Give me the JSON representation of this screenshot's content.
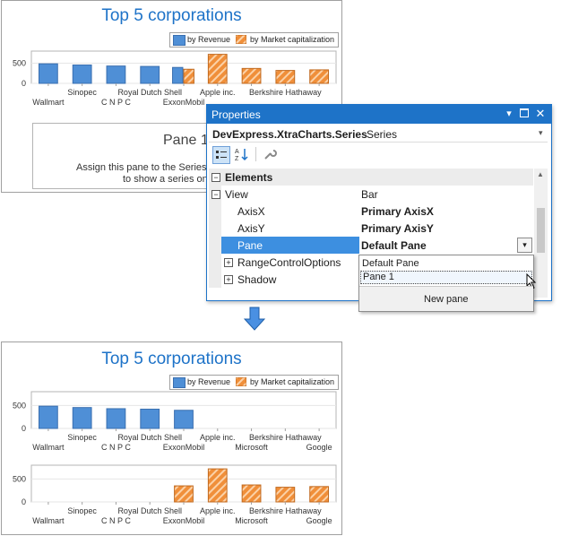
{
  "top_chart": {
    "title": "Top 5 corporations",
    "legend": {
      "revenue": "by Revenue",
      "market_cap": "by Market capitalization"
    },
    "y_ticks": [
      "500",
      "0"
    ],
    "x_labels_row1": [
      "Sinopec",
      "Royal Dutch Shell",
      "Apple inc.",
      "Berkshire Hathaway"
    ],
    "x_labels_row2": [
      "Wallmart",
      "C N P C",
      "ExxonMobil"
    ],
    "pane_title": "Pane 1",
    "pane_text_line1": "Assign this pane to the Series.",
    "pane_text_line2": "to show a series on"
  },
  "properties": {
    "caption": "Properties",
    "object_name": "DevExpress.XtraCharts.Series",
    "object_type": "Series",
    "category": "Elements",
    "rows": [
      {
        "key": "View",
        "value": "Bar"
      },
      {
        "key": "AxisX",
        "value": "Primary AxisX"
      },
      {
        "key": "AxisY",
        "value": "Primary AxisY"
      },
      {
        "key": "Pane",
        "value": "Default Pane"
      },
      {
        "key": "RangeControlOptions",
        "value": ""
      },
      {
        "key": "Shadow",
        "value": ""
      }
    ],
    "dropdown_options": [
      "Default Pane",
      "Pane 1"
    ],
    "new_pane": "New pane"
  },
  "bottom_chart": {
    "title": "Top 5 corporations",
    "legend": {
      "revenue": "by Revenue",
      "market_cap": "by Market capitalization"
    },
    "y_ticks": [
      "500",
      "0"
    ],
    "x_labels_row1": [
      "Sinopec",
      "Royal Dutch Shell",
      "Apple inc.",
      "Berkshire Hathaway"
    ],
    "x_labels_row2": [
      "Wallmart",
      "C N P C",
      "ExxonMobil",
      "Microsoft",
      "Google"
    ]
  },
  "colors": {
    "revenue": "#4f8fd6",
    "market_cap": "#f08f3a",
    "accent": "#1e73c8"
  },
  "chart_data": [
    {
      "type": "bar",
      "title": "Top 5 corporations",
      "categories": [
        "Wallmart",
        "Sinopec",
        "C N P C",
        "Royal Dutch Shell",
        "ExxonMobil",
        "Apple inc.",
        "Microsoft",
        "Berkshire Hathaway",
        "Google"
      ],
      "series": [
        {
          "name": "by Revenue",
          "values": [
            485,
            455,
            430,
            420,
            395,
            null,
            null,
            null,
            null
          ]
        },
        {
          "name": "by Market capitalization",
          "values": [
            null,
            null,
            null,
            null,
            350,
            720,
            370,
            320,
            335
          ]
        }
      ],
      "ylim": [
        0,
        800
      ],
      "grid": true,
      "legend_position": "top-right"
    },
    {
      "type": "bar",
      "title": "Top 5 corporations",
      "categories": [
        "Wallmart",
        "Sinopec",
        "C N P C",
        "Royal Dutch Shell",
        "ExxonMobil"
      ],
      "series": [
        {
          "name": "by Revenue",
          "values": [
            485,
            455,
            430,
            420,
            395
          ]
        }
      ],
      "ylim": [
        0,
        800
      ],
      "grid": true
    },
    {
      "type": "bar",
      "categories": [
        "ExxonMobil",
        "Apple inc.",
        "Microsoft",
        "Berkshire Hathaway",
        "Google"
      ],
      "series": [
        {
          "name": "by Market capitalization",
          "values": [
            350,
            720,
            370,
            320,
            335
          ]
        }
      ],
      "ylim": [
        0,
        800
      ],
      "grid": true
    }
  ]
}
